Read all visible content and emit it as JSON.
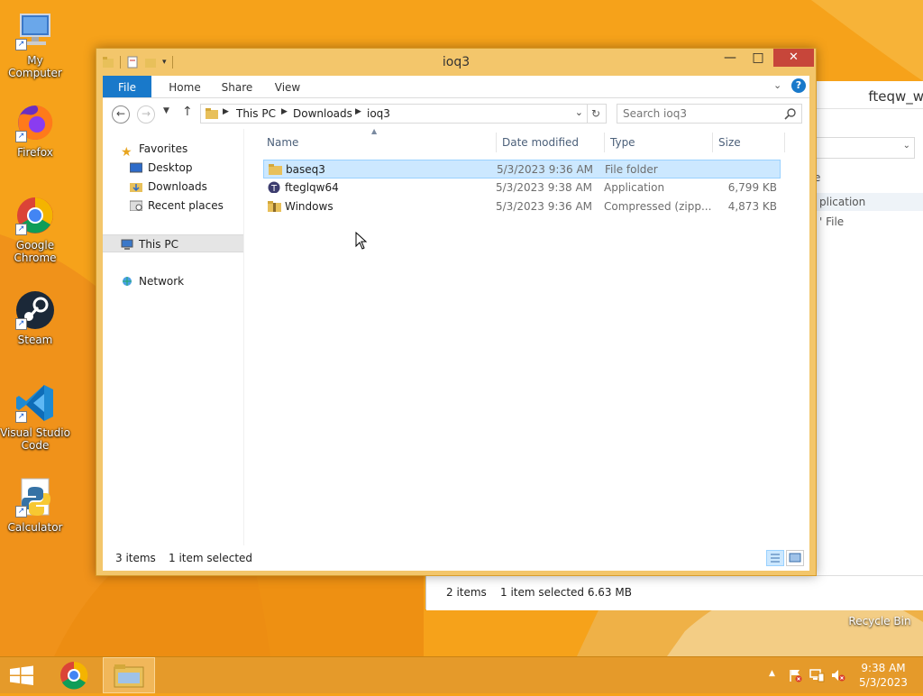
{
  "desktop": {
    "icons": [
      {
        "label": "My Computer",
        "icon": "computer-icon"
      },
      {
        "label": "Firefox",
        "icon": "firefox-icon"
      },
      {
        "label": "Google Chrome",
        "icon": "chrome-icon"
      },
      {
        "label": "Steam",
        "icon": "steam-icon"
      },
      {
        "label": "Visual Studio Code",
        "icon": "vscode-icon"
      },
      {
        "label": "Calculator",
        "icon": "python-icon"
      }
    ],
    "recycle_bin": "Recycle Bin"
  },
  "background_window": {
    "title": "fteqw_w",
    "text_type": "e",
    "text_app": "plication",
    "text_file": "' File",
    "status_items": "2 items",
    "status_selected": "1 item selected  6.63 MB"
  },
  "explorer": {
    "title": "ioq3",
    "ribbon_tabs": {
      "file": "File",
      "home": "Home",
      "share": "Share",
      "view": "View"
    },
    "address": {
      "this_pc": "This PC",
      "downloads": "Downloads",
      "current": "ioq3"
    },
    "search_placeholder": "Search ioq3",
    "nav": {
      "favorites": "Favorites",
      "desktop": "Desktop",
      "downloads": "Downloads",
      "recent": "Recent places",
      "this_pc": "This PC",
      "network": "Network"
    },
    "columns": {
      "name": "Name",
      "date": "Date modified",
      "type": "Type",
      "size": "Size"
    },
    "files": [
      {
        "name": "baseq3",
        "date": "5/3/2023 9:36 AM",
        "type": "File folder",
        "size": "",
        "icon": "folder-icon",
        "selected": true
      },
      {
        "name": "fteglqw64",
        "date": "5/3/2023 9:38 AM",
        "type": "Application",
        "size": "6,799 KB",
        "icon": "app-icon",
        "selected": false
      },
      {
        "name": "Windows",
        "date": "5/3/2023 9:36 AM",
        "type": "Compressed (zipp...",
        "size": "4,873 KB",
        "icon": "zip-folder-icon",
        "selected": false
      }
    ],
    "status": {
      "items": "3 items",
      "selected": "1 item selected"
    }
  },
  "taskbar": {
    "clock_time": "9:38 AM",
    "clock_date": "5/3/2023",
    "tray_icons": [
      "chevron-up-icon",
      "flag-icon",
      "network-icon",
      "volume-muted-icon"
    ]
  },
  "colors": {
    "accent": "#1979ca",
    "selection": "#cce8ff",
    "desktop": "#f6a21a"
  }
}
